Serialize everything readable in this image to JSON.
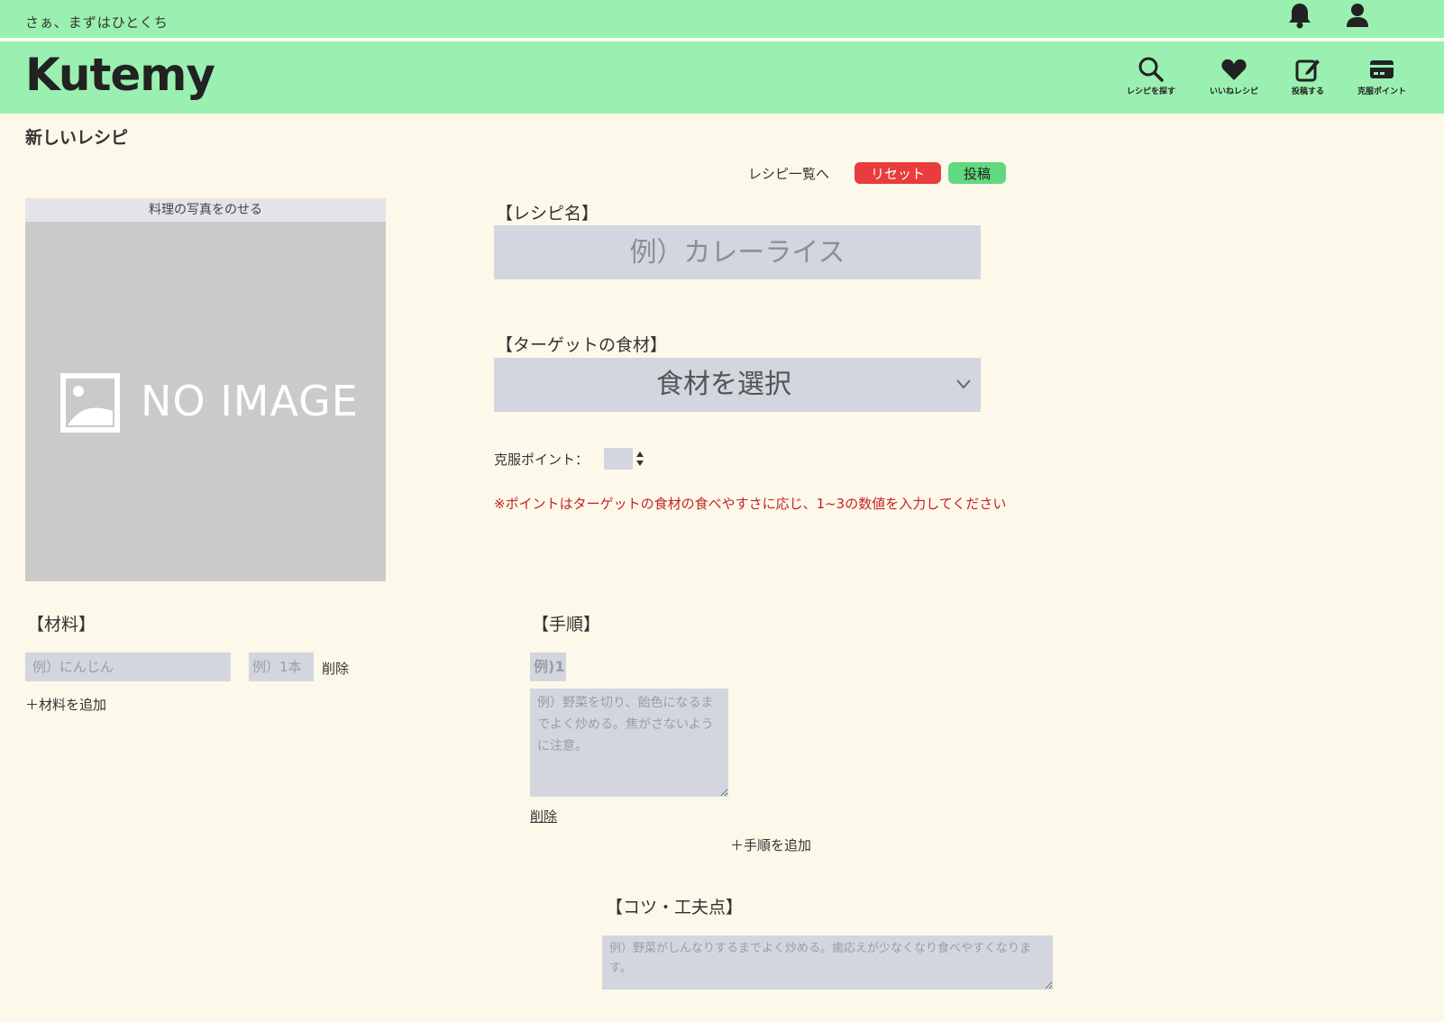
{
  "header": {
    "tagline": "さぁ、まずはひとくち",
    "logo": "Kutemy",
    "nav": [
      {
        "label": "レシピを探す",
        "icon": "search-icon"
      },
      {
        "label": "いいねレシピ",
        "icon": "heart-icon"
      },
      {
        "label": "投稿する",
        "icon": "edit-icon"
      },
      {
        "label": "克服ポイント",
        "icon": "card-icon"
      }
    ],
    "top_icons": [
      "bell-icon",
      "user-icon"
    ]
  },
  "page": {
    "title": "新しいレシピ",
    "actions": {
      "back_link": "レシピ一覧へ",
      "reset": "リセット",
      "post": "投稿"
    }
  },
  "photo": {
    "label": "料理の写真をのせる",
    "placeholder": "NO IMAGE"
  },
  "form": {
    "recipe_name": {
      "label": "【レシピ名】",
      "placeholder": "例）カレーライス"
    },
    "target_ingredient": {
      "label": "【ターゲットの食材】",
      "selected": "食材を選択"
    },
    "points": {
      "label": "克服ポイント：",
      "value": "",
      "note": "※ポイントはターゲットの食材の食べやすさに応じ、1~3の数値を入力してください"
    },
    "ingredients": {
      "label": "【材料】",
      "name_placeholder": "例）にんじん",
      "qty_placeholder": "例）1本",
      "delete": "削除",
      "add": "＋材料を追加"
    },
    "steps": {
      "label": "【手順】",
      "number_placeholder": "例)1",
      "text_placeholder": "例）野菜を切り、飴色になるまでよく炒める。焦がさないように注意。",
      "delete": "削除",
      "add": "＋手順を追加"
    },
    "tips": {
      "label": "【コツ・工夫点】",
      "placeholder": "例）野菜がしんなりするまでよく炒める。歯応えが少なくなり食べやすくなります。"
    }
  },
  "colors": {
    "header_bg": "#9af0b0",
    "page_bg": "#fdf9ea",
    "input_bg": "#d3d6de",
    "reset_btn": "#e93c3c",
    "post_btn": "#60d97f",
    "note_text": "#c42222"
  }
}
